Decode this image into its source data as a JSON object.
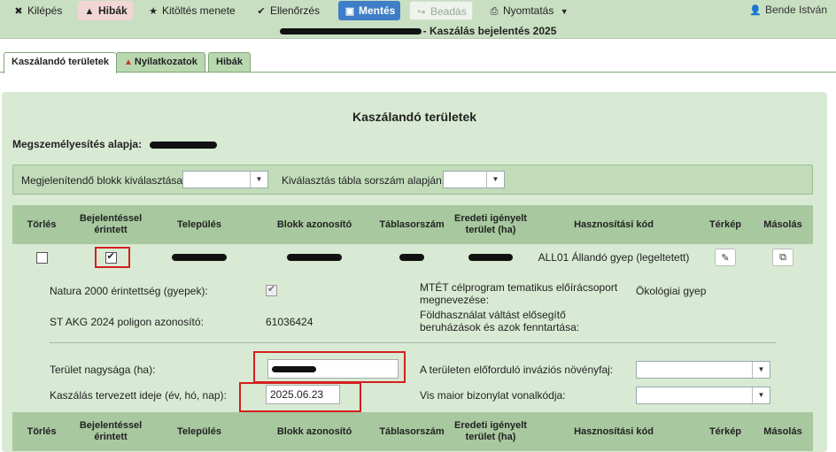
{
  "toolbar": {
    "exit_label": "Kilépés",
    "errors_label": "Hibák",
    "process_label": "Kitöltés menete",
    "check_label": "Ellenőrzés",
    "save_label": "Mentés",
    "submit_label": "Beadás",
    "print_label": "Nyomtatás",
    "user_name": "Bende István"
  },
  "page_title": "- Kaszálás bejelentés 2025",
  "tabs": [
    {
      "label": "Kaszálandó területek",
      "active": true
    },
    {
      "label": "Nyilatkozatok",
      "active": false
    },
    {
      "label": "Hibák",
      "active": false
    }
  ],
  "section": {
    "title": "Kaszálandó területek",
    "id_basis_label": "Megszemélyesítés alapja:"
  },
  "filters": {
    "block_select_label": "Megjelenítendő blokk kiválasztása:",
    "table_select_label": "Kiválasztás tábla sorszám alapján:"
  },
  "table": {
    "columns": [
      "Törlés",
      "Bejelentéssel érintett",
      "Település",
      "Blokk azonosító",
      "Táblasorszám",
      "Eredeti igényelt terület (ha)",
      "Hasznosítási kód",
      "Térkép",
      "Másolás"
    ],
    "rows": [
      {
        "land_use_code": "ALL01 Állandó gyep (legeltetett)",
        "delete_checked": false,
        "affected_checked": true
      }
    ]
  },
  "details": {
    "natura_label": "Natura 2000 érintettség (gyepek):",
    "natura_checked": true,
    "mtet_label": "MTÉT célprogram tematikus előírácsoport megnevezése:",
    "mtet_value": "Ökológiai gyep",
    "polygon_label": "ST AKG 2024 poligon azonosító:",
    "polygon_value": "61036424",
    "land_use_change_label": "Földhasználat váltást elősegítő beruházások és azok fenntartása:",
    "area_label": "Terület nagysága (ha):",
    "invasive_label": "A területen előforduló inváziós növényfaj:",
    "mowing_date_label": "Kaszálás tervezett ideje (év, hó, nap):",
    "mowing_date_value": "2025.06.23",
    "vis_maior_label": "Vis maior bizonylat vonalkódja:"
  },
  "colors": {
    "toolbar_bg": "#c9dfc2",
    "panel_bg": "#d8ead3",
    "header_bg": "#a8c89f",
    "save_blue": "#3f7ec7",
    "highlight_red": "#d32020"
  }
}
